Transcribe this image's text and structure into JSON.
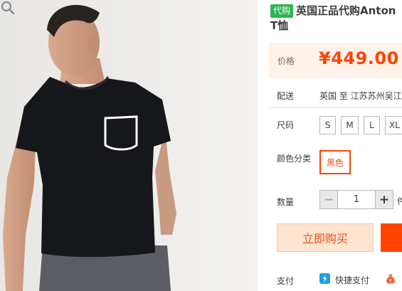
{
  "product": {
    "badge": "代购",
    "title_line1": "英国正品代购Anton",
    "title_line2": "T恤"
  },
  "price": {
    "label": "价格",
    "value": "¥449.00"
  },
  "shipping": {
    "label": "配送",
    "text": "英国 至  江苏苏州吴江"
  },
  "size": {
    "label": "尺码",
    "options": [
      "S",
      "M",
      "L",
      "XL"
    ]
  },
  "color": {
    "label": "颜色分类",
    "selected": "黑色"
  },
  "quantity": {
    "label": "数量",
    "value": "1",
    "minus": "−",
    "plus": "+",
    "extra": "件"
  },
  "actions": {
    "buy_now": "立即购买"
  },
  "payment": {
    "label": "支付",
    "method": "快捷支付"
  },
  "colors": {
    "accent": "#ff4400",
    "badge": "#2fb451",
    "price_bg": "#fff2e8"
  }
}
